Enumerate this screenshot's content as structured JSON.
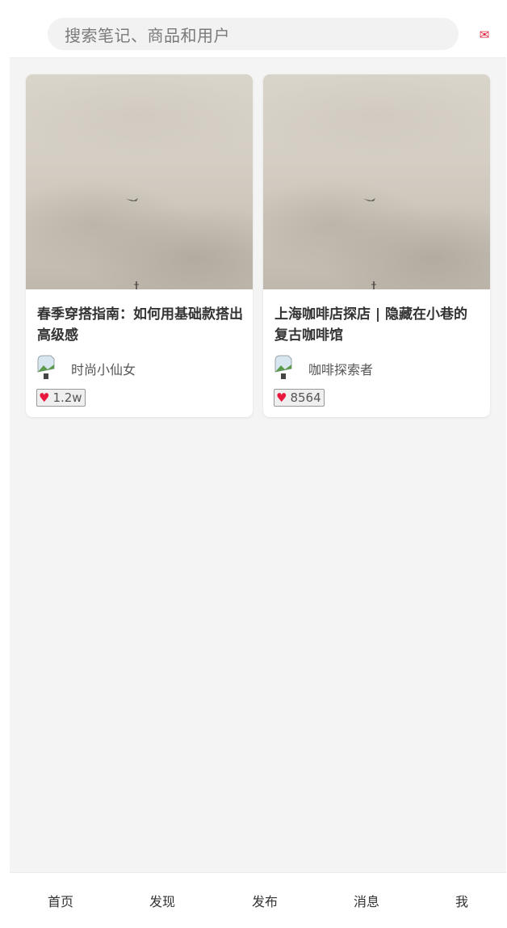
{
  "search": {
    "placeholder": "搜索笔记、商品和用户"
  },
  "header": {
    "message_icon": "mail-icon",
    "accent_color": "#e0203a"
  },
  "feed": {
    "cards": [
      {
        "title": "春季穿搭指南：如何用基础款搭出高级感",
        "author": "时尚小仙女",
        "likes": "1.2w",
        "cover_icon": "sky-plane-photo"
      },
      {
        "title": "上海咖啡店探店 | 隐藏在小巷的复古咖啡馆",
        "author": "咖啡探索者",
        "likes": "8564",
        "cover_icon": "sky-plane-photo"
      }
    ]
  },
  "tabbar": {
    "tabs": [
      {
        "label": "首页"
      },
      {
        "label": "发现"
      },
      {
        "label": "发布"
      },
      {
        "label": "消息"
      },
      {
        "label": "我"
      }
    ]
  },
  "like_icon": {
    "glyph": "♥",
    "color": "#e8193c"
  }
}
